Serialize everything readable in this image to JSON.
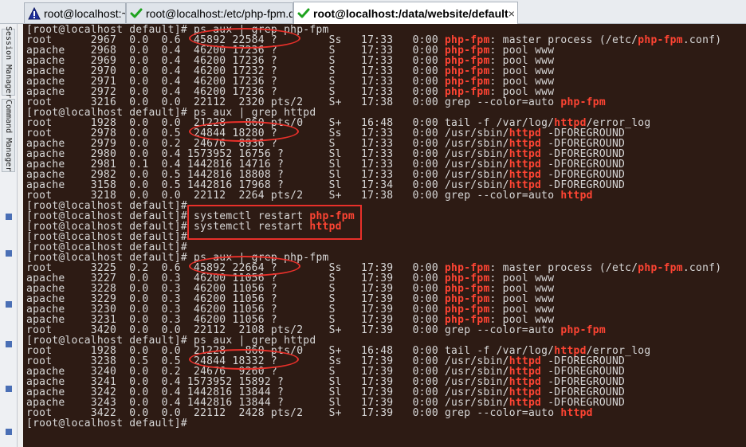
{
  "tabs": [
    {
      "label": "root@localhost:~",
      "icon": "warning-triangle-icon",
      "active": false
    },
    {
      "label": "root@localhost:/etc/php-fpm.d",
      "icon": "green-check-icon",
      "active": false
    },
    {
      "label": "root@localhost:/data/website/default",
      "icon": "green-check-icon",
      "active": true,
      "close": "×"
    }
  ],
  "sidebar": {
    "session_manager": "Session Manager",
    "command_manager": "Command Manager"
  },
  "terminal": {
    "highlight_keywords": [
      "php-fpm",
      "httpd"
    ],
    "lines": [
      "[root@localhost default]# ps aux | grep php-fpm",
      "root      2967  0.0  0.6  45892 22584 ?        Ss   17:33   0:00 php-fpm: master process (/etc/php-fpm.conf)",
      "apache    2968  0.0  0.4  46200 17236 ?        S    17:33   0:00 php-fpm: pool www",
      "apache    2969  0.0  0.4  46200 17236 ?        S    17:33   0:00 php-fpm: pool www",
      "apache    2970  0.0  0.4  46200 17232 ?        S    17:33   0:00 php-fpm: pool www",
      "apache    2971  0.0  0.4  46200 17236 ?        S    17:33   0:00 php-fpm: pool www",
      "apache    2972  0.0  0.4  46200 17236 ?        S    17:33   0:00 php-fpm: pool www",
      "root      3216  0.0  0.0  22112  2320 pts/2    S+   17:38   0:00 grep --color=auto php-fpm",
      "[root@localhost default]# ps aux | grep httpd",
      "root      1928  0.0  0.0  21228   860 pts/0    S+   16:48   0:00 tail -f /var/log/httpd/error_log",
      "root      2978  0.0  0.5  24844 18280 ?        Ss   17:33   0:00 /usr/sbin/httpd -DFOREGROUND",
      "apache    2979  0.0  0.2  24676  8936 ?        S    17:33   0:00 /usr/sbin/httpd -DFOREGROUND",
      "apache    2980  0.0  0.4 1573952 16756 ?       Sl   17:33   0:00 /usr/sbin/httpd -DFOREGROUND",
      "apache    2981  0.1  0.4 1442816 14716 ?       Sl   17:33   0:00 /usr/sbin/httpd -DFOREGROUND",
      "apache    2982  0.0  0.5 1442816 18808 ?       Sl   17:33   0:00 /usr/sbin/httpd -DFOREGROUND",
      "apache    3158  0.0  0.5 1442816 17968 ?       Sl   17:34   0:00 /usr/sbin/httpd -DFOREGROUND",
      "root      3218  0.0  0.0  22112  2264 pts/2    S+   17:38   0:00 grep --color=auto httpd",
      "[root@localhost default]#",
      "[root@localhost default]# systemctl restart php-fpm",
      "[root@localhost default]# systemctl restart httpd",
      "[root@localhost default]#",
      "[root@localhost default]#",
      "[root@localhost default]# ps aux | grep php-fpm",
      "root      3225  0.2  0.6  45892 22664 ?        Ss   17:39   0:00 php-fpm: master process (/etc/php-fpm.conf)",
      "apache    3227  0.0  0.3  46200 11056 ?        S    17:39   0:00 php-fpm: pool www",
      "apache    3228  0.0  0.3  46200 11056 ?        S    17:39   0:00 php-fpm: pool www",
      "apache    3229  0.0  0.3  46200 11056 ?        S    17:39   0:00 php-fpm: pool www",
      "apache    3230  0.0  0.3  46200 11056 ?        S    17:39   0:00 php-fpm: pool www",
      "apache    3231  0.0  0.3  46200 11056 ?        S    17:39   0:00 php-fpm: pool www",
      "root      3420  0.0  0.0  22112  2108 pts/2    S+   17:39   0:00 grep --color=auto php-fpm",
      "[root@localhost default]# ps aux | grep httpd",
      "root      1928  0.0  0.0  21228   860 pts/0    S+   16:48   0:00 tail -f /var/log/httpd/error_log",
      "root      3238  0.5  0.5  24844 18332 ?        Ss   17:39   0:00 /usr/sbin/httpd -DFOREGROUND",
      "apache    3240  0.0  0.2  24676  9260 ?        S    17:39   0:00 /usr/sbin/httpd -DFOREGROUND",
      "apache    3241  0.0  0.4 1573952 15892 ?       Sl   17:39   0:00 /usr/sbin/httpd -DFOREGROUND",
      "apache    3242  0.0  0.4 1442816 13844 ?       Sl   17:39   0:00 /usr/sbin/httpd -DFOREGROUND",
      "apache    3243  0.0  0.4 1442816 13844 ?       Sl   17:39   0:00 /usr/sbin/httpd -DFOREGROUND",
      "root      3422  0.0  0.0  22112  2428 pts/2    S+   17:39   0:00 grep --color=auto httpd",
      "[root@localhost default]#"
    ]
  },
  "colors": {
    "terminal_bg": "#2d1b14",
    "terminal_fg": "#d8d8d8",
    "highlight": "#ff4433",
    "annotation": "#e8302a"
  }
}
